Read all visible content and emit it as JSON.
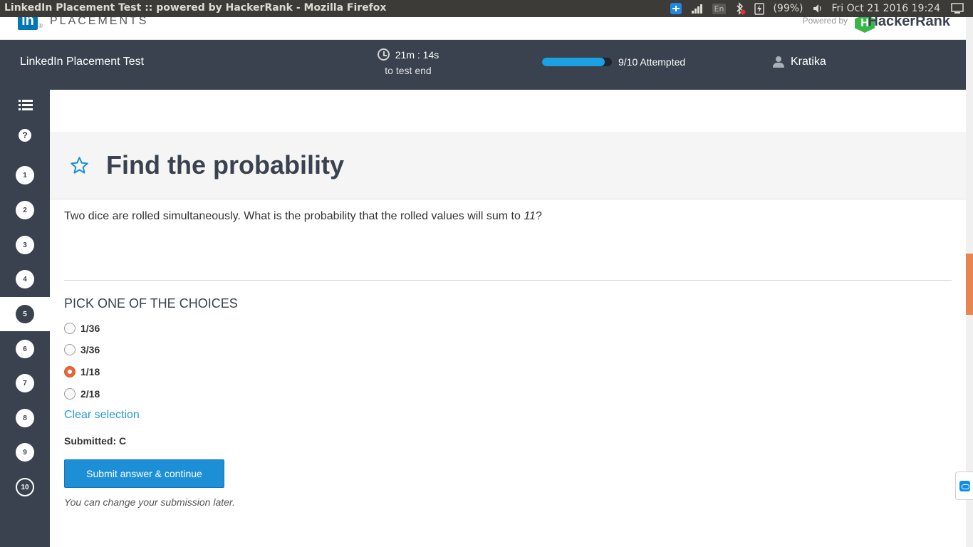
{
  "window": {
    "title": "LinkedIn Placement Test :: powered by HackerRank - Mozilla Firefox"
  },
  "tray": {
    "language": "En",
    "battery": "(99%)",
    "clock": "Fri Oct 21 2016 19:24"
  },
  "brand": {
    "placements": "PLACEMENTS",
    "li_mark": "in",
    "li_registered": "®",
    "powered_by": "Powered by",
    "hr_mark": "H",
    "hackerrank": "HackerRank"
  },
  "header": {
    "test_title": "LinkedIn Placement Test",
    "timer": "21m : 14s",
    "timer_sub": "to test end",
    "progress_label": "9/10 Attempted",
    "progress_fraction": 0.9,
    "username": "Kratika"
  },
  "sidebar": {
    "help_glyph": "?",
    "questions": [
      "1",
      "2",
      "3",
      "4",
      "5",
      "6",
      "7",
      "8",
      "9",
      "10"
    ],
    "active_question": "5",
    "unattempted": [
      "10"
    ]
  },
  "question": {
    "title": "Find the probability",
    "text_before": "Two dice are rolled simultaneously. What is the probability that the rolled values will sum to ",
    "text_number": "11",
    "text_after": "?",
    "pick_label": "PICK ONE OF THE CHOICES",
    "choices": [
      {
        "label": "1/36",
        "checked": false
      },
      {
        "label": "3/36",
        "checked": false
      },
      {
        "label": "1/18",
        "checked": true
      },
      {
        "label": "2/18",
        "checked": false
      }
    ],
    "clear_label": "Clear selection",
    "submitted": "Submitted: C",
    "submit_label": "Submit answer & continue",
    "note": "You can change your submission later."
  },
  "colors": {
    "header_bg": "#39424e",
    "accent": "#1c8fd6",
    "radio_checked": "#e4683a",
    "hackerrank_green": "#39b54a",
    "linkedin_blue": "#0077b5"
  },
  "icons": [
    "clock-icon",
    "user-icon",
    "list-icon",
    "help-icon",
    "star-icon",
    "teamviewer-icon"
  ]
}
